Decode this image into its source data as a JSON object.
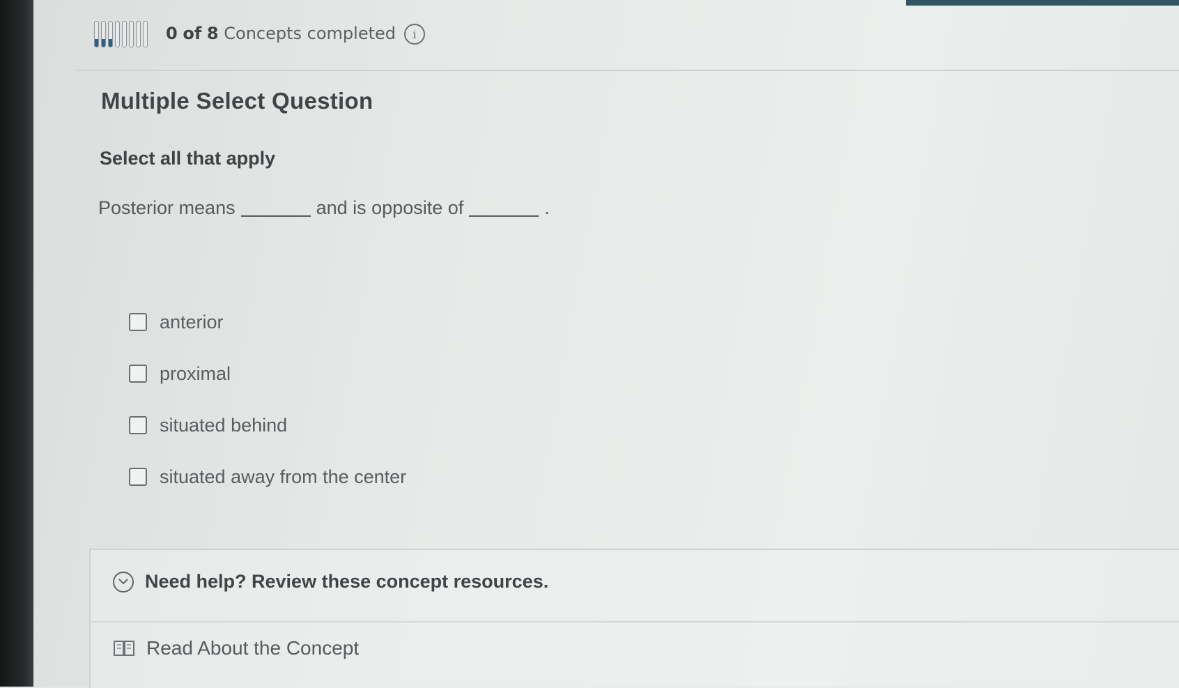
{
  "progress": {
    "completed": "0",
    "text_of": "of",
    "total": "8",
    "label": "Concepts completed",
    "segments": 8,
    "fill_fraction": 0.3,
    "filled_segments": 3
  },
  "question": {
    "type_label": "Multiple Select Question",
    "instruction": "Select all that apply",
    "prompt_part1": "Posterior means",
    "prompt_part2": "and is opposite of",
    "prompt_end": ".",
    "options": [
      {
        "label": "anterior",
        "checked": false
      },
      {
        "label": "proximal",
        "checked": false
      },
      {
        "label": "situated behind",
        "checked": false
      },
      {
        "label": "situated away from the center",
        "checked": false
      }
    ]
  },
  "help": {
    "toggle_label": "Need help? Review these concept resources.",
    "resource_label": "Read About the Concept"
  },
  "icons": {
    "info": "info-icon",
    "toggle": "chevron-down-circle-icon",
    "resource": "book-icon"
  },
  "colors": {
    "progress_fill": "#2b5f86",
    "top_accent": "#2f5661"
  }
}
